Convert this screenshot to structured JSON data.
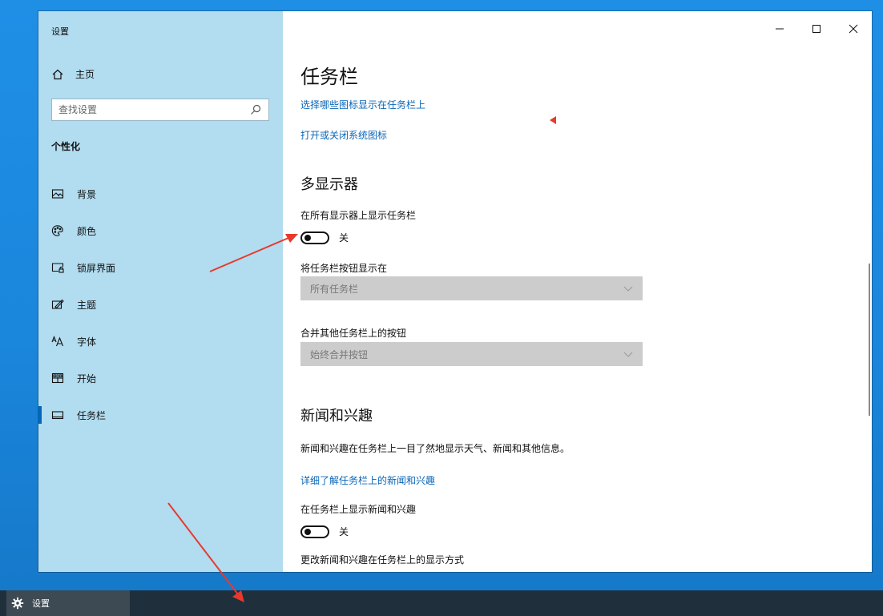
{
  "app": {
    "title": "设置"
  },
  "sidebar": {
    "home_label": "主页",
    "search_placeholder": "查找设置",
    "section": "个性化",
    "items": [
      {
        "label": "背景",
        "icon": "image-icon"
      },
      {
        "label": "颜色",
        "icon": "palette-icon"
      },
      {
        "label": "锁屏界面",
        "icon": "lockscreen-icon"
      },
      {
        "label": "主题",
        "icon": "theme-icon"
      },
      {
        "label": "字体",
        "icon": "font-icon"
      },
      {
        "label": "开始",
        "icon": "start-icon"
      },
      {
        "label": "任务栏",
        "icon": "taskbar-icon",
        "active": true
      }
    ]
  },
  "content": {
    "title": "任务栏",
    "links": {
      "choose_icons": "选择哪些图标显示在任务栏上",
      "system_icons": "打开或关闭系统图标"
    },
    "multi_display": {
      "heading": "多显示器",
      "show_all_label": "在所有显示器上显示任务栏",
      "show_all_state": "关",
      "buttons_on_label": "将任务栏按钮显示在",
      "buttons_on_value": "所有任务栏",
      "combine_label": "合并其他任务栏上的按钮",
      "combine_value": "始终合并按钮"
    },
    "news": {
      "heading": "新闻和兴趣",
      "desc": "新闻和兴趣在任务栏上一目了然地显示天气、新闻和其他信息。",
      "learn_more": "详细了解任务栏上的新闻和兴趣",
      "show_label": "在任务栏上显示新闻和兴趣",
      "show_state": "关",
      "change_label": "更改新闻和兴趣在任务栏上的显示方式"
    }
  },
  "taskbar": {
    "app_label": "设置"
  },
  "colors": {
    "accent": "#0067c0",
    "link": "#0a66b8",
    "sidebar_bg": "#b2dcef",
    "arrow": "#e8392c"
  }
}
